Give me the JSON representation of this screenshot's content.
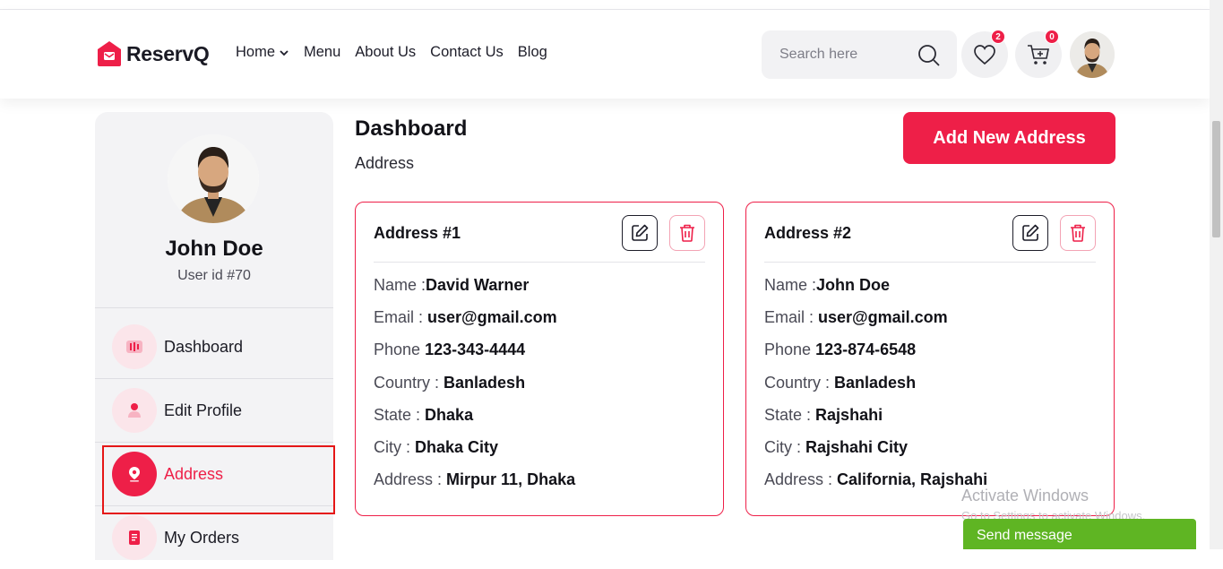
{
  "brand": {
    "name": "ReservQ",
    "accent": "#EE1F48"
  },
  "nav": [
    {
      "label": "Home",
      "has_dropdown": true
    },
    {
      "label": "Menu"
    },
    {
      "label": "About Us"
    },
    {
      "label": "Contact Us"
    },
    {
      "label": "Blog"
    }
  ],
  "search": {
    "placeholder": "Search here"
  },
  "badges": {
    "wishlist": "2",
    "cart": "0"
  },
  "profile": {
    "name": "John Doe",
    "user_id": "User id #70"
  },
  "sidebar": {
    "items": [
      {
        "label": "Dashboard",
        "icon": "bar-chart-icon"
      },
      {
        "label": "Edit Profile",
        "icon": "user-icon"
      },
      {
        "label": "Address",
        "icon": "location-pin-icon",
        "active": true
      },
      {
        "label": "My Orders",
        "icon": "receipt-icon"
      }
    ]
  },
  "page": {
    "title": "Dashboard",
    "subtitle": "Address",
    "add_button": "Add New Address"
  },
  "addresses": [
    {
      "title": "Address #1",
      "name_label": "Name :",
      "name": "David Warner",
      "email_label": "Email : ",
      "email": "user@gmail.com",
      "phone_label": "Phone ",
      "phone": "123-343-4444",
      "country_label": "Country : ",
      "country": "Banladesh",
      "state_label": "State : ",
      "state": "Dhaka",
      "city_label": "City : ",
      "city": "Dhaka City",
      "address_label": "Address : ",
      "address": "Mirpur 11, Dhaka"
    },
    {
      "title": "Address #2",
      "name_label": "Name :",
      "name": "John Doe",
      "email_label": "Email : ",
      "email": "user@gmail.com",
      "phone_label": "Phone ",
      "phone": "123-874-6548",
      "country_label": "Country : ",
      "country": "Banladesh",
      "state_label": "State : ",
      "state": "Rajshahi",
      "city_label": "City : ",
      "city": "Rajshahi City",
      "address_label": "Address : ",
      "address": "California, Rajshahi"
    }
  ],
  "watermark": {
    "line1": "Activate Windows",
    "line2": "Go to Settings to activate Windows."
  },
  "chat": {
    "label": "Send message"
  }
}
